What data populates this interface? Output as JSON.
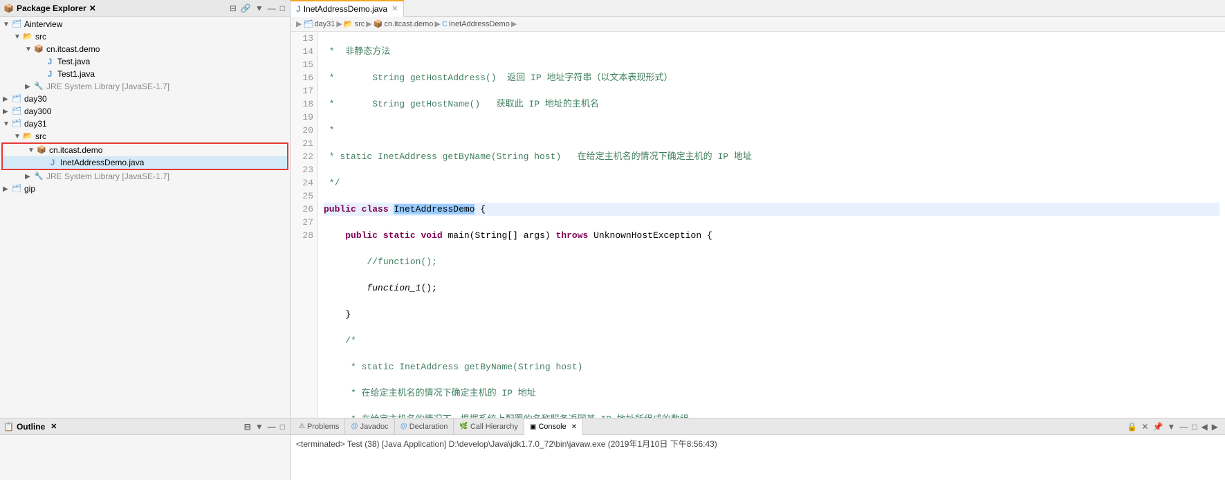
{
  "sidebar": {
    "title": "Package Explorer",
    "close_icon": "✕",
    "items": [
      {
        "id": "ainterview",
        "label": "Ainterview",
        "indent": 0,
        "icon": "📁",
        "arrow": "▼",
        "type": "project"
      },
      {
        "id": "src1",
        "label": "src",
        "indent": 1,
        "icon": "📂",
        "arrow": "▼",
        "type": "folder"
      },
      {
        "id": "cn.itcast.demo1",
        "label": "cn.itcast.demo",
        "indent": 2,
        "icon": "📦",
        "arrow": "▼",
        "type": "package"
      },
      {
        "id": "test1",
        "label": "Test.java",
        "indent": 3,
        "icon": "J",
        "arrow": "",
        "type": "java"
      },
      {
        "id": "test1b",
        "label": "Test1.java",
        "indent": 3,
        "icon": "J",
        "arrow": "",
        "type": "java"
      },
      {
        "id": "jre1",
        "label": "JRE System Library [JavaSE-1.7]",
        "indent": 2,
        "icon": "🔧",
        "arrow": "▶",
        "type": "lib"
      },
      {
        "id": "day30",
        "label": "day30",
        "indent": 0,
        "icon": "📁",
        "arrow": "▶",
        "type": "project"
      },
      {
        "id": "day300",
        "label": "day300",
        "indent": 0,
        "icon": "📁",
        "arrow": "▶",
        "type": "project"
      },
      {
        "id": "day31",
        "label": "day31",
        "indent": 0,
        "icon": "📁",
        "arrow": "▼",
        "type": "project"
      },
      {
        "id": "src2",
        "label": "src",
        "indent": 1,
        "icon": "📂",
        "arrow": "▼",
        "type": "folder"
      },
      {
        "id": "cn.itcast.demo2",
        "label": "cn.itcast.demo",
        "indent": 2,
        "icon": "📦",
        "arrow": "▼",
        "type": "package",
        "red_border_start": true
      },
      {
        "id": "inetaddr",
        "label": "InetAddressDemo.java",
        "indent": 3,
        "icon": "J",
        "arrow": "",
        "type": "java",
        "selected": true,
        "red_border_end": true
      },
      {
        "id": "jre2",
        "label": "JRE System Library [JavaSE-1.7]",
        "indent": 2,
        "icon": "🔧",
        "arrow": "▶",
        "type": "lib"
      },
      {
        "id": "gip",
        "label": "gip",
        "indent": 0,
        "icon": "📁",
        "arrow": "▶",
        "type": "project"
      }
    ]
  },
  "editor": {
    "tab_label": "InetAddressDemo.java",
    "breadcrumb": [
      "day31",
      "src",
      "cn.itcast.demo",
      "InetAddressDemo"
    ],
    "lines": [
      {
        "num": 13,
        "code": " *  非静态方法",
        "type": "comment"
      },
      {
        "num": 14,
        "code": " *       String getHostAddress()  返回 IP 地址字符串（以文本表现形式）",
        "type": "comment"
      },
      {
        "num": 15,
        "code": " *       String getHostName()   获取此 IP 地址的主机名",
        "type": "comment"
      },
      {
        "num": 16,
        "code": " *",
        "type": "comment"
      },
      {
        "num": 17,
        "code": " * static InetAddress getByName(String host)   在给定主机名的情况下确定主机的 IP 地址",
        "type": "comment"
      },
      {
        "num": 18,
        "code": " */",
        "type": "comment"
      },
      {
        "num": 19,
        "code": "public class InetAddressDemo {",
        "type": "class_decl",
        "highlighted": true
      },
      {
        "num": 20,
        "code": "    public static void main(String[] args) throws UnknownHostException {",
        "type": "method"
      },
      {
        "num": 21,
        "code": "        //function();",
        "type": "comment_inline"
      },
      {
        "num": 22,
        "code": "        function_1();",
        "type": "italic_call"
      },
      {
        "num": 23,
        "code": "    }",
        "type": "normal"
      },
      {
        "num": 24,
        "code": "    /*",
        "type": "comment"
      },
      {
        "num": 25,
        "code": "     * static InetAddress getByName(String host)",
        "type": "comment"
      },
      {
        "num": 26,
        "code": "     * 在给定主机名的情况下确定主机的 IP 地址",
        "type": "comment"
      },
      {
        "num": 27,
        "code": "     * 在给定主机名的情况下，根据系统上配置的名称服务返回其 IP 地址所组成的数组",
        "type": "comment"
      },
      {
        "num": 28,
        "code": "     */",
        "type": "comment"
      }
    ]
  },
  "bottom_tabs": [
    {
      "id": "problems",
      "label": "Problems",
      "icon": "⚠",
      "active": false
    },
    {
      "id": "javadoc",
      "label": "Javadoc",
      "icon": "@",
      "active": false
    },
    {
      "id": "declaration",
      "label": "Declaration",
      "icon": "@",
      "active": false
    },
    {
      "id": "call-hierarchy",
      "label": "Call Hierarchy",
      "icon": "🌿",
      "active": false
    },
    {
      "id": "console",
      "label": "Console",
      "icon": "▣",
      "active": true
    }
  ],
  "console_content": "<terminated> Test (38) [Java Application] D:\\develop\\Java\\jdk1.7.0_72\\bin\\javaw.exe (2019年1月10日 下午8:56:43)",
  "outline": {
    "title": "Outline"
  }
}
